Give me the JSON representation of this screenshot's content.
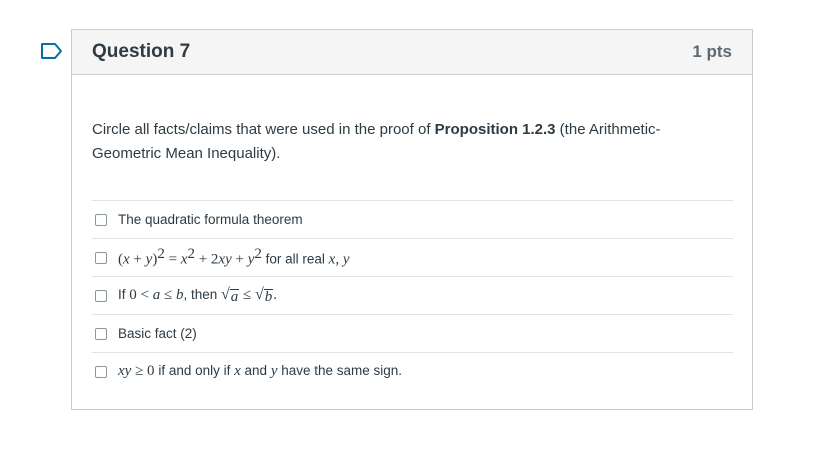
{
  "question": {
    "title": "Question 7",
    "points": "1 pts",
    "text_before": "Circle all facts/claims that were used in the proof of ",
    "text_bold": "Proposition 1.2.3",
    "text_after": " (the Arithmetic-Geometric Mean Inequality)."
  },
  "answers": {
    "a1": "The quadratic formula theorem",
    "a2_suffix": " for all real ",
    "a2_vars": "x, y",
    "a3_if": "If ",
    "a3_then": ", then ",
    "a4": "Basic fact (2)",
    "a5_mid": " if and only if ",
    "a5_and": " and ",
    "a5_end": " have the same sign."
  }
}
